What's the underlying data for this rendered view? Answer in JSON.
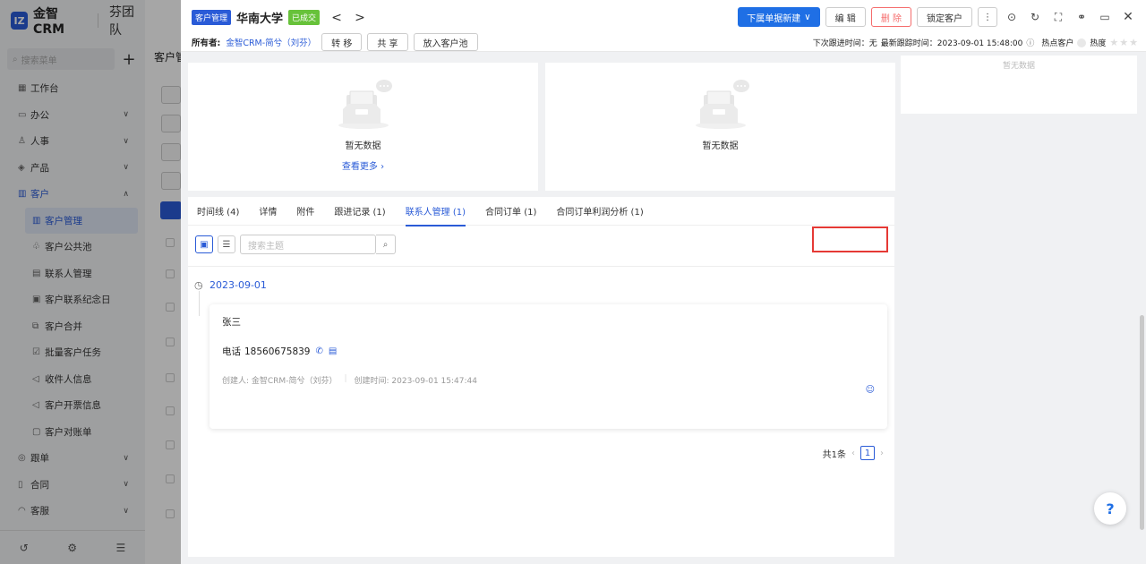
{
  "sidebar": {
    "brand": "金智CRM",
    "team": "芬团队",
    "search_placeholder": "搜索菜单",
    "items": [
      {
        "label": "工作台",
        "icon": "dashboard-icon",
        "chevron": ""
      },
      {
        "label": "办公",
        "icon": "office-icon",
        "chevron": "∨"
      },
      {
        "label": "人事",
        "icon": "people-icon",
        "chevron": "∨"
      },
      {
        "label": "产品",
        "icon": "product-icon",
        "chevron": "∨"
      },
      {
        "label": "客户",
        "icon": "customer-icon",
        "chevron": "∧"
      },
      {
        "label": "客户管理",
        "icon": "customer-manage-icon",
        "chevron": ""
      },
      {
        "label": "客户公共池",
        "icon": "pool-icon",
        "chevron": ""
      },
      {
        "label": "联系人管理",
        "icon": "contact-icon",
        "chevron": ""
      },
      {
        "label": "客户联系纪念日",
        "icon": "calendar-icon",
        "chevron": ""
      },
      {
        "label": "客户合并",
        "icon": "merge-icon",
        "chevron": ""
      },
      {
        "label": "批量客户任务",
        "icon": "task-icon",
        "chevron": ""
      },
      {
        "label": "收件人信息",
        "icon": "recipient-icon",
        "chevron": ""
      },
      {
        "label": "客户开票信息",
        "icon": "invoice-icon",
        "chevron": ""
      },
      {
        "label": "客户对账单",
        "icon": "statement-icon",
        "chevron": ""
      },
      {
        "label": "跟单",
        "icon": "follow-icon",
        "chevron": "∨"
      },
      {
        "label": "合同",
        "icon": "contract-icon",
        "chevron": "∨"
      },
      {
        "label": "客服",
        "icon": "service-icon",
        "chevron": "∨"
      }
    ]
  },
  "background": {
    "title": "客户管"
  },
  "header": {
    "module_tag": "客户管理",
    "customer_name": "华南大学",
    "status_tag": "已成交",
    "prev": "<",
    "next": ">",
    "new_button": "下属单据新建",
    "edit_button": "编 辑",
    "delete_button": "删 除",
    "lock_button": "锁定客户",
    "owner_label": "所有者:",
    "owner_value": "金智CRM-简兮（刘芬）",
    "transfer_button": "转 移",
    "share_button": "共 享",
    "to_pool_button": "放入客户池",
    "next_follow": "下次跟进时间：无",
    "last_follow": "最新跟踪时间：2023-09-01 15:48:00",
    "hot_customer": "热点客户",
    "heat_label": "热度",
    "stars": "★★★",
    "heat_rating": 0
  },
  "cards": {
    "empty_text_1": "暂无数据",
    "view_more": "查看更多",
    "empty_text_2": "暂无数据",
    "right_empty": "暂无数据"
  },
  "tabs": [
    {
      "label": "时间线 (4)"
    },
    {
      "label": "详情"
    },
    {
      "label": "附件"
    },
    {
      "label": "跟进记录 (1)"
    },
    {
      "label": "联系人管理 (1)"
    },
    {
      "label": "合同订单 (1)"
    },
    {
      "label": "合同订单利润分析 (1)"
    }
  ],
  "active_tab": "联系人管理 (1)",
  "toolbar": {
    "search_placeholder": "搜索主题"
  },
  "timeline": {
    "date": "2023-09-01",
    "contact": {
      "name": "张三",
      "phone_label": "电话",
      "phone": "18560675839",
      "creator": "创建人: 金智CRM-简兮（刘芬）",
      "created_time": "创建时间: 2023-09-01 15:47:44"
    }
  },
  "pagination": {
    "total": "共1条",
    "current": "1"
  },
  "colors": {
    "primary": "#1f6fe5",
    "danger": "#f56c6c",
    "success": "#67c23a",
    "highlight_box": "#e53935"
  }
}
